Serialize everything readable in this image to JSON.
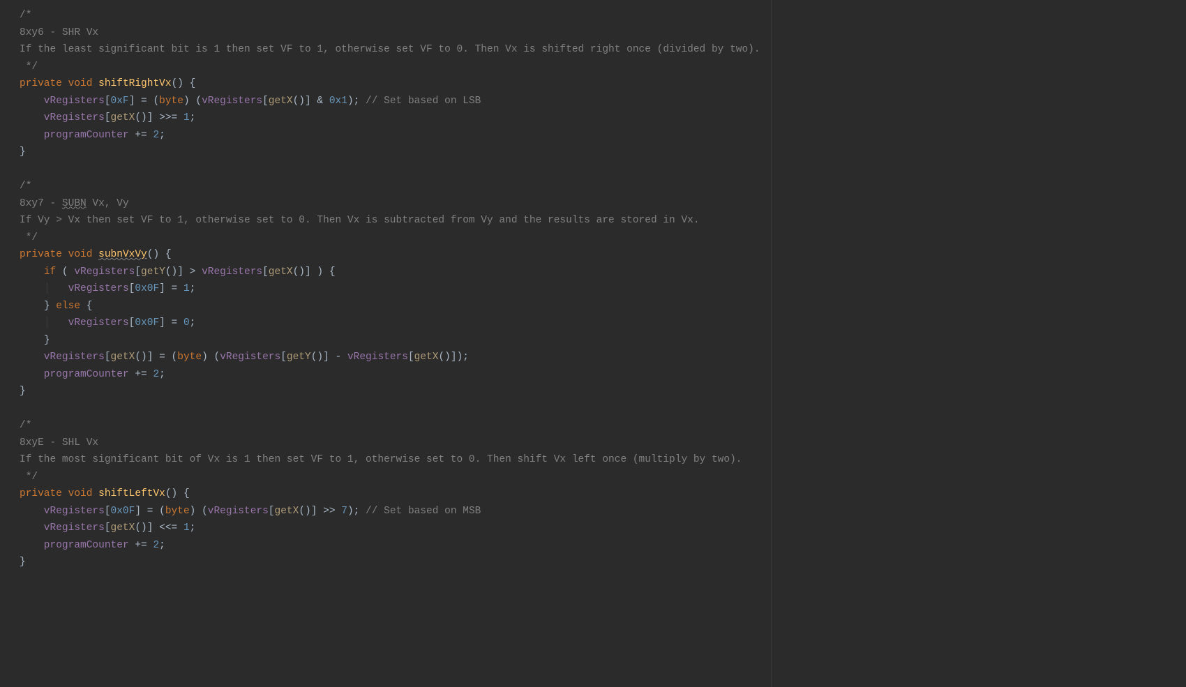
{
  "lines": {
    "l1": "/*",
    "l2": "8xy6 - SHR Vx",
    "l3": "If the least significant bit is 1 then set VF to 1, otherwise set VF to 0. Then Vx is shifted right once (divided by two).",
    "l4": " */",
    "l6a": "    vRegisters",
    "l6b": "0xF",
    "l6c": "byte",
    "l6d": "vRegisters",
    "l6e": "getX",
    "l6f": "0x1",
    "l6g": "// Set based on LSB",
    "l7a": "    vRegisters",
    "l7b": "getX",
    "l7c": "1",
    "l8a": "    programCounter ",
    "l8b": "2",
    "l10": "/*",
    "l11a": "8xy7 - ",
    "l11b": "SUBN",
    "l11c": " Vx, Vy",
    "l12": "If Vy > Vx then set VF to 1, otherwise set to 0. Then Vx is subtracted from Vy and the results are stored in Vx.",
    "l13": " */",
    "l14b": "subnVxVy",
    "l15if": "if",
    "l15a": "vRegisters",
    "l15b": "getY",
    "l15c": "vRegisters",
    "l15d": "getX",
    "l16a": "vRegisters",
    "l16b": "0x0F",
    "l16c": "1",
    "l17else": "else",
    "l18a": "vRegisters",
    "l18b": "0x0F",
    "l18c": "0",
    "l20a": "    vRegisters",
    "l20b": "getX",
    "l20c": "byte",
    "l20d": "vRegisters",
    "l20e": "getY",
    "l20f": "vRegisters",
    "l20g": "getX",
    "l21a": "    programCounter ",
    "l21b": "2",
    "l23": "/*",
    "l24": "8xyE - SHL Vx",
    "l25": "If the most significant bit of Vx is 1 then set VF to 1, otherwise set to 0. Then shift Vx left once (multiply by two).",
    "l26": " */",
    "l28a": "    vRegisters",
    "l28b": "0x0F",
    "l28c": "byte",
    "l28d": "vRegisters",
    "l28e": "getX",
    "l28f": "7",
    "l28g": "// Set based on MSB",
    "l29a": "    vRegisters",
    "l29b": "getX",
    "l29c": "1",
    "l30a": "    programCounter ",
    "l30b": "2",
    "kw_private": "private",
    "kw_void": "void",
    "m1": "shiftRightVx",
    "m3": "shiftLeftVx"
  }
}
